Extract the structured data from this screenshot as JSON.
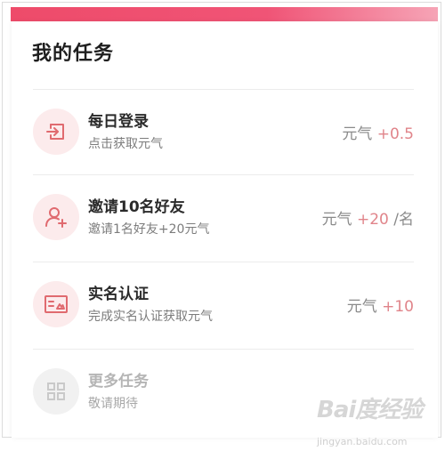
{
  "panel": {
    "title": "我的任务"
  },
  "tasks": [
    {
      "name": "每日登录",
      "desc": "点击获取元气",
      "reward_label": "元气",
      "reward_amount": "+0.5",
      "reward_suffix": "",
      "icon": "login-icon",
      "enabled": true
    },
    {
      "name": "邀请10名好友",
      "desc": "邀请1名好友+20元气",
      "reward_label": "元气",
      "reward_amount": "+20",
      "reward_suffix": "/名",
      "icon": "add-user-icon",
      "enabled": true
    },
    {
      "name": "实名认证",
      "desc": "完成实名认证获取元气",
      "reward_label": "元气",
      "reward_amount": "+10",
      "reward_suffix": "",
      "icon": "id-card-icon",
      "enabled": true
    },
    {
      "name": "更多任务",
      "desc": "敬请期待",
      "icon": "grid-icon",
      "enabled": false
    }
  ],
  "watermark": {
    "text": "Bai度经验",
    "sub": "jingyan.baidu.com"
  },
  "colors": {
    "accent": "#ee4b6a",
    "icon": "#e06a6f",
    "icon_bg": "#fcebec",
    "reward_amount": "#e0848a"
  }
}
